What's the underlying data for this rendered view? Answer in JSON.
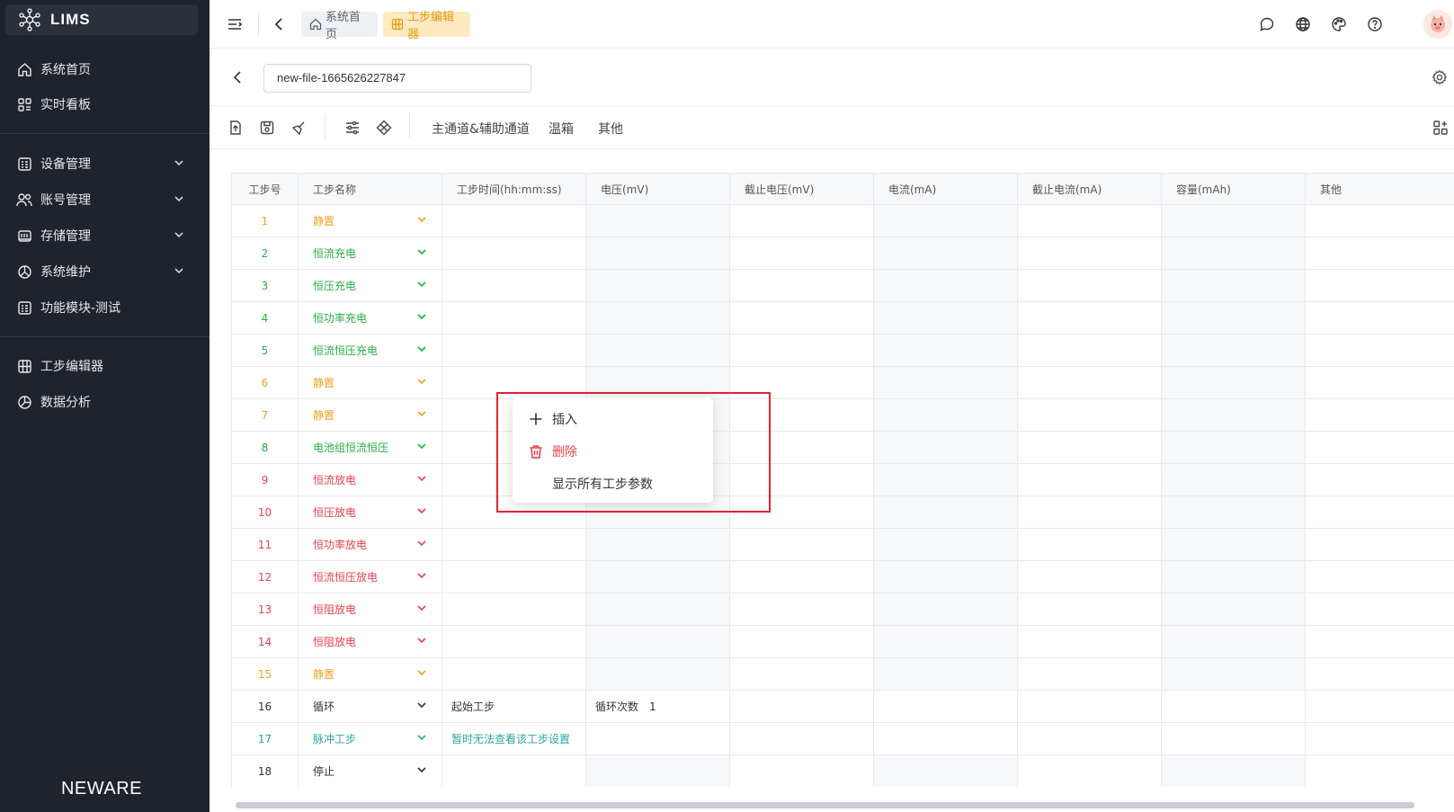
{
  "sidebar": {
    "app_name": "LIMS",
    "brand": "NEWARE",
    "items": [
      {
        "label": "系统首页",
        "icon": "home-icon"
      },
      {
        "label": "实时看板",
        "icon": "dashboard-icon"
      },
      {
        "label": "设备管理",
        "icon": "device-icon",
        "expandable": true
      },
      {
        "label": "账号管理",
        "icon": "users-icon",
        "expandable": true
      },
      {
        "label": "存储管理",
        "icon": "storage-icon",
        "expandable": true
      },
      {
        "label": "系统维护",
        "icon": "maintenance-icon",
        "expandable": true
      },
      {
        "label": "功能模块-测试",
        "icon": "module-icon"
      },
      {
        "label": "工步编辑器",
        "icon": "grid-icon"
      },
      {
        "label": "数据分析",
        "icon": "pie-chart-icon"
      }
    ]
  },
  "header": {
    "breadcrumbs": [
      {
        "label": "系统首页",
        "icon": "home-icon"
      },
      {
        "label": "工步编辑器",
        "icon": "grid-icon",
        "active": true
      }
    ]
  },
  "file": {
    "name": "new-file-1665626227847"
  },
  "toolbar": {
    "tabs": [
      "主通道&辅助通道",
      "温箱",
      "其他"
    ]
  },
  "table": {
    "columns": [
      "工步号",
      "工步名称",
      "工步时间(hh:mm:ss)",
      "电压(mV)",
      "截止电压(mV)",
      "电流(mA)",
      "截止电流(mA)",
      "容量(mAh)",
      "其他"
    ],
    "rows": [
      {
        "no": "1",
        "name": "静置",
        "color": "orange"
      },
      {
        "no": "2",
        "name": "恒流充电",
        "color": "green"
      },
      {
        "no": "3",
        "name": "恒压充电",
        "color": "green"
      },
      {
        "no": "4",
        "name": "恒功率充电",
        "color": "green"
      },
      {
        "no": "5",
        "name": "恒流恒压充电",
        "color": "green"
      },
      {
        "no": "6",
        "name": "静置",
        "color": "orange"
      },
      {
        "no": "7",
        "name": "静置",
        "color": "orange"
      },
      {
        "no": "8",
        "name": "电池组恒流恒压",
        "color": "green"
      },
      {
        "no": "9",
        "name": "恒流放电",
        "color": "red"
      },
      {
        "no": "10",
        "name": "恒压放电",
        "color": "red"
      },
      {
        "no": "11",
        "name": "恒功率放电",
        "color": "red"
      },
      {
        "no": "12",
        "name": "恒流恒压放电",
        "color": "red"
      },
      {
        "no": "13",
        "name": "恒阻放电",
        "color": "red"
      },
      {
        "no": "14",
        "name": "恒阻放电",
        "color": "red"
      },
      {
        "no": "15",
        "name": "静置",
        "color": "orange"
      },
      {
        "no": "16",
        "name": "循环",
        "color": "dark",
        "time_cell": "起始工步",
        "voltage_label": "循环次数",
        "voltage_value": "1"
      },
      {
        "no": "17",
        "name": "脉冲工步",
        "color": "teal",
        "time_cell": "暂时无法查看该工步设置"
      },
      {
        "no": "18",
        "name": "停止",
        "color": "dark"
      }
    ]
  },
  "context_menu": {
    "items": [
      {
        "label": "插入",
        "icon": "plus-icon"
      },
      {
        "label": "删除",
        "icon": "trash-icon",
        "danger": true
      },
      {
        "label": "显示所有工步参数",
        "icon": ""
      }
    ]
  },
  "colors": {
    "sidebar_bg": "#1e232c",
    "accent": "#f0a020",
    "green": "#27ae45",
    "red": "#e8414d",
    "teal": "#2ba89c"
  }
}
